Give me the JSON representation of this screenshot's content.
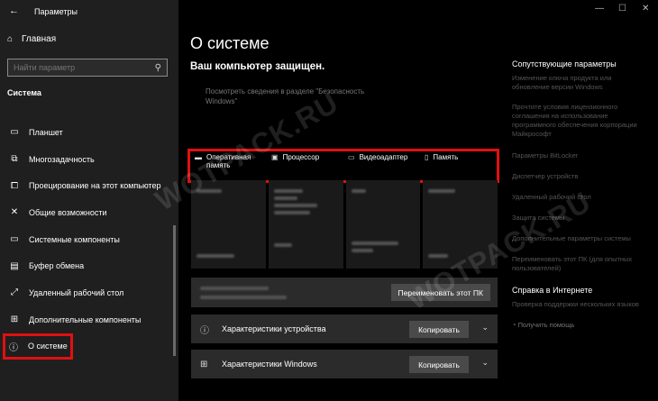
{
  "window": {
    "title": "Параметры",
    "controls": [
      "—",
      "☐",
      "✕"
    ]
  },
  "sidebar": {
    "home_label": "Главная",
    "search_placeholder": "Найти параметр",
    "section_label": "Система",
    "items": [
      {
        "label": "Планшет",
        "icon": "tablet-icon"
      },
      {
        "label": "Многозадачность",
        "icon": "multitask-icon"
      },
      {
        "label": "Проецирование на этот компьютер",
        "icon": "project-icon"
      },
      {
        "label": "Общие возможности",
        "icon": "shared-icon"
      },
      {
        "label": "Системные компоненты",
        "icon": "components-icon"
      },
      {
        "label": "Буфер обмена",
        "icon": "clipboard-icon"
      },
      {
        "label": "Удаленный рабочий стол",
        "icon": "remote-icon"
      },
      {
        "label": "Дополнительные компоненты",
        "icon": "addons-icon"
      },
      {
        "label": "О системе",
        "icon": "info-icon",
        "active": true
      }
    ]
  },
  "main": {
    "title": "О системе",
    "protected_text": "Ваш компьютер защищен.",
    "security_link": "Посмотреть сведения в разделе \"Безопасность Windows\"",
    "spec_headers": [
      "Оперативная память",
      "Процессор",
      "Видеоадаптер",
      "Память"
    ],
    "rename_button": "Переименовать этот ПК",
    "device_specs_label": "Характеристики устройства",
    "windows_specs_label": "Характеристики Windows",
    "copy_label": "Копировать"
  },
  "related": {
    "title": "Сопутствующие параметры",
    "links": [
      "Изменение ключа продукта или обновление версии Windows",
      "Прочтите условия лицензионного соглашения на использование программного обеспечения корпорации Майкрософт",
      "Параметры BitLocker",
      "Диспетчер устройств",
      "Удаленный рабочий стол",
      "Защита системы",
      "Дополнительные параметры системы",
      "Переименовать этот ПК (для опытных пользователей)"
    ],
    "help_title": "Справка в Интернете",
    "help_link": "Проверка поддержки нескольких языков",
    "get_help": "Получить помощь"
  },
  "watermark": "WOTPACK.RU"
}
